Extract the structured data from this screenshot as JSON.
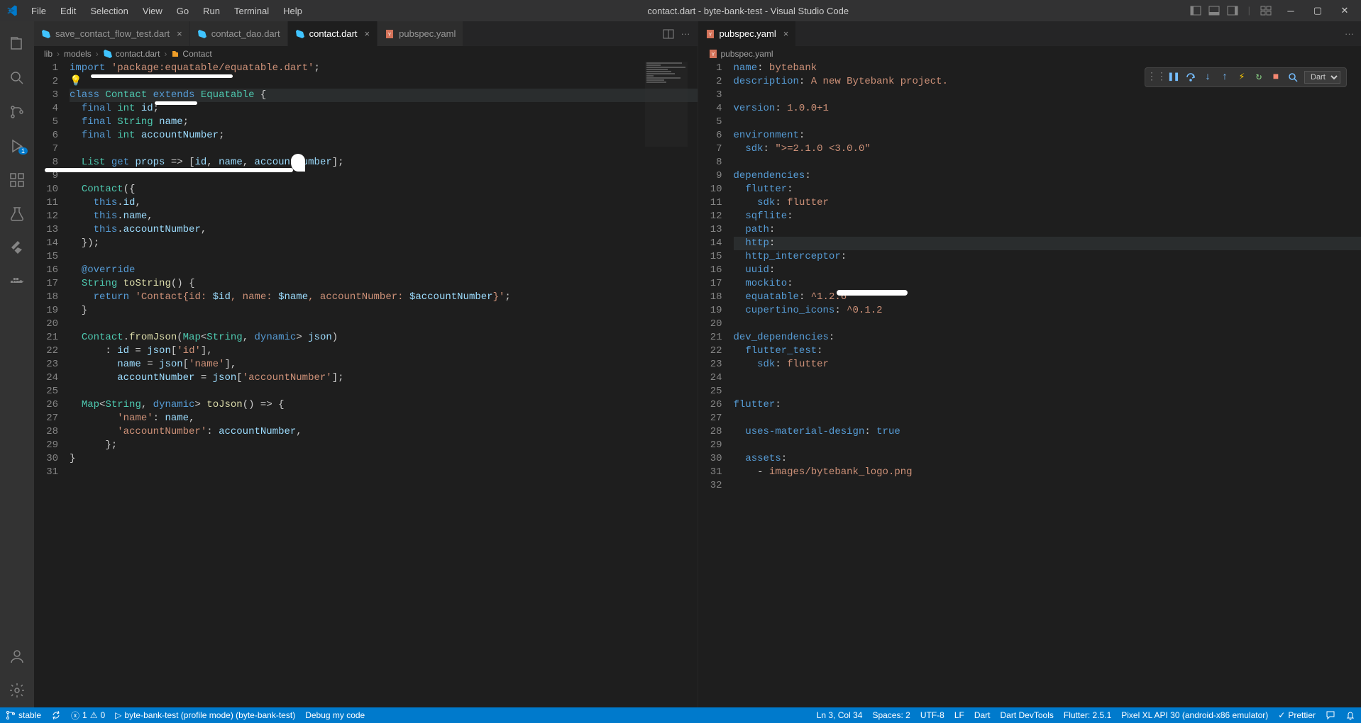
{
  "titlebar": {
    "menus": [
      "File",
      "Edit",
      "Selection",
      "View",
      "Go",
      "Run",
      "Terminal",
      "Help"
    ],
    "title": "contact.dart - byte-bank-test - Visual Studio Code"
  },
  "activity_badge": "1",
  "pane_left": {
    "tabs": [
      {
        "icon": "dart",
        "label": "save_contact_flow_test.dart",
        "active": false,
        "close": true
      },
      {
        "icon": "dart",
        "label": "contact_dao.dart",
        "active": false,
        "close": false
      },
      {
        "icon": "dart",
        "label": "contact.dart",
        "active": true,
        "close": true
      },
      {
        "icon": "yaml",
        "label": "pubspec.yaml",
        "active": false,
        "close": false
      }
    ],
    "breadcrumb": [
      "lib",
      "models",
      "contact.dart",
      "Contact"
    ],
    "code": [
      {
        "n": 1,
        "tokens": [
          [
            "kw",
            "import "
          ],
          [
            "str",
            "'package:equatable/equatable.dart'"
          ],
          [
            "punct",
            ";"
          ]
        ]
      },
      {
        "n": 2,
        "tokens": [
          [
            "bulb",
            "💡"
          ]
        ]
      },
      {
        "n": 3,
        "hl": true,
        "tokens": [
          [
            "kw",
            "class "
          ],
          [
            "type",
            "Contact"
          ],
          [
            "punct",
            " "
          ],
          [
            "kw",
            "extends"
          ],
          [
            "punct",
            " "
          ],
          [
            "type",
            "Equatable"
          ],
          [
            "punct",
            " {"
          ]
        ]
      },
      {
        "n": 4,
        "tokens": [
          [
            "punct",
            "  "
          ],
          [
            "kw",
            "final "
          ],
          [
            "type",
            "int"
          ],
          [
            "punct",
            " "
          ],
          [
            "ident",
            "id"
          ],
          [
            "punct",
            ";"
          ]
        ]
      },
      {
        "n": 5,
        "tokens": [
          [
            "punct",
            "  "
          ],
          [
            "kw",
            "final "
          ],
          [
            "type",
            "String"
          ],
          [
            "punct",
            " "
          ],
          [
            "ident",
            "name"
          ],
          [
            "punct",
            ";"
          ]
        ]
      },
      {
        "n": 6,
        "tokens": [
          [
            "punct",
            "  "
          ],
          [
            "kw",
            "final "
          ],
          [
            "type",
            "int"
          ],
          [
            "punct",
            " "
          ],
          [
            "ident",
            "accountNumber"
          ],
          [
            "punct",
            ";"
          ]
        ]
      },
      {
        "n": 7,
        "tokens": []
      },
      {
        "n": 8,
        "tokens": [
          [
            "punct",
            "  "
          ],
          [
            "type",
            "List"
          ],
          [
            "punct",
            " "
          ],
          [
            "kw",
            "get"
          ],
          [
            "punct",
            " "
          ],
          [
            "ident",
            "props"
          ],
          [
            "punct",
            " => ["
          ],
          [
            "ident",
            "id"
          ],
          [
            "punct",
            ", "
          ],
          [
            "ident",
            "name"
          ],
          [
            "punct",
            ", "
          ],
          [
            "ident",
            "accountNumber"
          ],
          [
            "punct",
            "];"
          ]
        ]
      },
      {
        "n": 9,
        "tokens": []
      },
      {
        "n": 10,
        "tokens": [
          [
            "punct",
            "  "
          ],
          [
            "type",
            "Contact"
          ],
          [
            "punct",
            "({"
          ]
        ]
      },
      {
        "n": 11,
        "tokens": [
          [
            "punct",
            "    "
          ],
          [
            "kw",
            "this"
          ],
          [
            "punct",
            "."
          ],
          [
            "ident",
            "id"
          ],
          [
            "punct",
            ","
          ]
        ]
      },
      {
        "n": 12,
        "tokens": [
          [
            "punct",
            "    "
          ],
          [
            "kw",
            "this"
          ],
          [
            "punct",
            "."
          ],
          [
            "ident",
            "name"
          ],
          [
            "punct",
            ","
          ]
        ]
      },
      {
        "n": 13,
        "tokens": [
          [
            "punct",
            "    "
          ],
          [
            "kw",
            "this"
          ],
          [
            "punct",
            "."
          ],
          [
            "ident",
            "accountNumber"
          ],
          [
            "punct",
            ","
          ]
        ]
      },
      {
        "n": 14,
        "tokens": [
          [
            "punct",
            "  });"
          ]
        ]
      },
      {
        "n": 15,
        "tokens": []
      },
      {
        "n": 16,
        "tokens": [
          [
            "punct",
            "  "
          ],
          [
            "anno",
            "@override"
          ]
        ]
      },
      {
        "n": 17,
        "tokens": [
          [
            "punct",
            "  "
          ],
          [
            "type",
            "String"
          ],
          [
            "punct",
            " "
          ],
          [
            "meth",
            "toString"
          ],
          [
            "punct",
            "() {"
          ]
        ]
      },
      {
        "n": 18,
        "tokens": [
          [
            "punct",
            "    "
          ],
          [
            "kw",
            "return"
          ],
          [
            "punct",
            " "
          ],
          [
            "str",
            "'Contact{id: "
          ],
          [
            "ident",
            "$id"
          ],
          [
            "str",
            ", name: "
          ],
          [
            "ident",
            "$name"
          ],
          [
            "str",
            ", accountNumber: "
          ],
          [
            "ident",
            "$accountNumber"
          ],
          [
            "str",
            "}'"
          ],
          [
            "punct",
            ";"
          ]
        ]
      },
      {
        "n": 19,
        "tokens": [
          [
            "punct",
            "  }"
          ]
        ]
      },
      {
        "n": 20,
        "tokens": []
      },
      {
        "n": 21,
        "tokens": [
          [
            "punct",
            "  "
          ],
          [
            "type",
            "Contact"
          ],
          [
            "punct",
            "."
          ],
          [
            "meth",
            "fromJson"
          ],
          [
            "punct",
            "("
          ],
          [
            "type",
            "Map"
          ],
          [
            "punct",
            "<"
          ],
          [
            "type",
            "String"
          ],
          [
            "punct",
            ", "
          ],
          [
            "kw",
            "dynamic"
          ],
          [
            "punct",
            "> "
          ],
          [
            "ident",
            "json"
          ],
          [
            "punct",
            ")"
          ]
        ]
      },
      {
        "n": 22,
        "tokens": [
          [
            "punct",
            "      : "
          ],
          [
            "ident",
            "id"
          ],
          [
            "punct",
            " = "
          ],
          [
            "ident",
            "json"
          ],
          [
            "punct",
            "["
          ],
          [
            "str",
            "'id'"
          ],
          [
            "punct",
            "],"
          ]
        ]
      },
      {
        "n": 23,
        "tokens": [
          [
            "punct",
            "        "
          ],
          [
            "ident",
            "name"
          ],
          [
            "punct",
            " = "
          ],
          [
            "ident",
            "json"
          ],
          [
            "punct",
            "["
          ],
          [
            "str",
            "'name'"
          ],
          [
            "punct",
            "],"
          ]
        ]
      },
      {
        "n": 24,
        "tokens": [
          [
            "punct",
            "        "
          ],
          [
            "ident",
            "accountNumber"
          ],
          [
            "punct",
            " = "
          ],
          [
            "ident",
            "json"
          ],
          [
            "punct",
            "["
          ],
          [
            "str",
            "'accountNumber'"
          ],
          [
            "punct",
            "];"
          ]
        ]
      },
      {
        "n": 25,
        "tokens": []
      },
      {
        "n": 26,
        "tokens": [
          [
            "punct",
            "  "
          ],
          [
            "type",
            "Map"
          ],
          [
            "punct",
            "<"
          ],
          [
            "type",
            "String"
          ],
          [
            "punct",
            ", "
          ],
          [
            "kw",
            "dynamic"
          ],
          [
            "punct",
            "> "
          ],
          [
            "meth",
            "toJson"
          ],
          [
            "punct",
            "() => {"
          ]
        ]
      },
      {
        "n": 27,
        "tokens": [
          [
            "punct",
            "        "
          ],
          [
            "str",
            "'name'"
          ],
          [
            "punct",
            ": "
          ],
          [
            "ident",
            "name"
          ],
          [
            "punct",
            ","
          ]
        ]
      },
      {
        "n": 28,
        "tokens": [
          [
            "punct",
            "        "
          ],
          [
            "str",
            "'accountNumber'"
          ],
          [
            "punct",
            ": "
          ],
          [
            "ident",
            "accountNumber"
          ],
          [
            "punct",
            ","
          ]
        ]
      },
      {
        "n": 29,
        "tokens": [
          [
            "punct",
            "      };"
          ]
        ]
      },
      {
        "n": 30,
        "tokens": [
          [
            "punct",
            "}"
          ]
        ]
      },
      {
        "n": 31,
        "tokens": []
      }
    ]
  },
  "pane_right": {
    "tabs": [
      {
        "icon": "yaml",
        "label": "pubspec.yaml",
        "active": true,
        "close": true
      }
    ],
    "breadcrumb": [
      "pubspec.yaml"
    ],
    "debug_toolbar_select": "Dart",
    "code": [
      {
        "n": 1,
        "tokens": [
          [
            "ykey",
            "name"
          ],
          [
            "punct",
            ": "
          ],
          [
            "yval",
            "bytebank"
          ]
        ]
      },
      {
        "n": 2,
        "tokens": [
          [
            "ykey",
            "description"
          ],
          [
            "punct",
            ": "
          ],
          [
            "yval",
            "A new Bytebank project."
          ]
        ]
      },
      {
        "n": 3,
        "tokens": []
      },
      {
        "n": 4,
        "tokens": [
          [
            "ykey",
            "version"
          ],
          [
            "punct",
            ": "
          ],
          [
            "yval",
            "1.0.0+1"
          ]
        ]
      },
      {
        "n": 5,
        "tokens": []
      },
      {
        "n": 6,
        "tokens": [
          [
            "ykey",
            "environment"
          ],
          [
            "punct",
            ":"
          ]
        ]
      },
      {
        "n": 7,
        "tokens": [
          [
            "punct",
            "  "
          ],
          [
            "ykey",
            "sdk"
          ],
          [
            "punct",
            ": "
          ],
          [
            "str",
            "\">=2.1.0 <3.0.0\""
          ]
        ]
      },
      {
        "n": 8,
        "tokens": []
      },
      {
        "n": 9,
        "tokens": [
          [
            "ykey",
            "dependencies"
          ],
          [
            "punct",
            ":"
          ]
        ]
      },
      {
        "n": 10,
        "tokens": [
          [
            "punct",
            "  "
          ],
          [
            "ykey",
            "flutter"
          ],
          [
            "punct",
            ":"
          ]
        ]
      },
      {
        "n": 11,
        "tokens": [
          [
            "punct",
            "    "
          ],
          [
            "ykey",
            "sdk"
          ],
          [
            "punct",
            ": "
          ],
          [
            "yval",
            "flutter"
          ]
        ]
      },
      {
        "n": 12,
        "tokens": [
          [
            "punct",
            "  "
          ],
          [
            "ykey",
            "sqflite"
          ],
          [
            "punct",
            ":"
          ]
        ]
      },
      {
        "n": 13,
        "tokens": [
          [
            "punct",
            "  "
          ],
          [
            "ykey",
            "path"
          ],
          [
            "punct",
            ":"
          ]
        ]
      },
      {
        "n": 14,
        "hl": true,
        "tokens": [
          [
            "punct",
            "  "
          ],
          [
            "ykey",
            "http"
          ],
          [
            "punct",
            ":"
          ]
        ]
      },
      {
        "n": 15,
        "tokens": [
          [
            "punct",
            "  "
          ],
          [
            "ykey",
            "http_interceptor"
          ],
          [
            "punct",
            ":"
          ]
        ]
      },
      {
        "n": 16,
        "tokens": [
          [
            "punct",
            "  "
          ],
          [
            "ykey",
            "uuid"
          ],
          [
            "punct",
            ":"
          ]
        ]
      },
      {
        "n": 17,
        "tokens": [
          [
            "punct",
            "  "
          ],
          [
            "ykey",
            "mockito"
          ],
          [
            "punct",
            ":"
          ]
        ]
      },
      {
        "n": 18,
        "tokens": [
          [
            "punct",
            "  "
          ],
          [
            "ykey",
            "equatable"
          ],
          [
            "punct",
            ": "
          ],
          [
            "yval",
            "^1.2.6"
          ]
        ]
      },
      {
        "n": 19,
        "tokens": [
          [
            "punct",
            "  "
          ],
          [
            "ykey",
            "cupertino_icons"
          ],
          [
            "punct",
            ": "
          ],
          [
            "yval",
            "^0.1.2"
          ]
        ]
      },
      {
        "n": 20,
        "tokens": []
      },
      {
        "n": 21,
        "tokens": [
          [
            "ykey",
            "dev_dependencies"
          ],
          [
            "punct",
            ":"
          ]
        ]
      },
      {
        "n": 22,
        "tokens": [
          [
            "punct",
            "  "
          ],
          [
            "ykey",
            "flutter_test"
          ],
          [
            "punct",
            ":"
          ]
        ]
      },
      {
        "n": 23,
        "tokens": [
          [
            "punct",
            "    "
          ],
          [
            "ykey",
            "sdk"
          ],
          [
            "punct",
            ": "
          ],
          [
            "yval",
            "flutter"
          ]
        ]
      },
      {
        "n": 24,
        "tokens": []
      },
      {
        "n": 25,
        "tokens": []
      },
      {
        "n": 26,
        "tokens": [
          [
            "ykey",
            "flutter"
          ],
          [
            "punct",
            ":"
          ]
        ]
      },
      {
        "n": 27,
        "tokens": []
      },
      {
        "n": 28,
        "tokens": [
          [
            "punct",
            "  "
          ],
          [
            "ykey",
            "uses-material-design"
          ],
          [
            "punct",
            ": "
          ],
          [
            "kw",
            "true"
          ]
        ]
      },
      {
        "n": 29,
        "tokens": []
      },
      {
        "n": 30,
        "tokens": [
          [
            "punct",
            "  "
          ],
          [
            "ykey",
            "assets"
          ],
          [
            "punct",
            ":"
          ]
        ]
      },
      {
        "n": 31,
        "tokens": [
          [
            "punct",
            "    - "
          ],
          [
            "yval",
            "images/bytebank_logo.png"
          ]
        ]
      },
      {
        "n": 32,
        "tokens": []
      }
    ]
  },
  "statusbar": {
    "branch": "stable",
    "sync": "",
    "problems": "1",
    "warnings": "0",
    "profile": "byte-bank-test (profile mode) (byte-bank-test)",
    "debug": "Debug my code",
    "cursor": "Ln 3, Col 34",
    "spaces": "Spaces: 2",
    "encoding": "UTF-8",
    "eol": "LF",
    "lang": "Dart",
    "devtools": "Dart DevTools",
    "flutter": "Flutter: 2.5.1",
    "device": "Pixel XL API 30 (android-x86 emulator)",
    "prettier": "Prettier"
  }
}
